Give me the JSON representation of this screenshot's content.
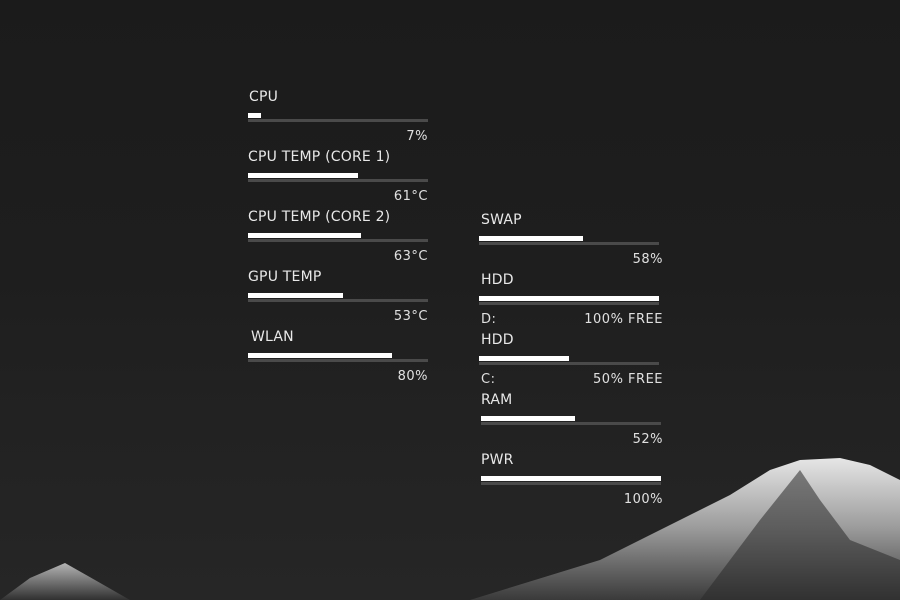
{
  "background": {
    "color": "#1e1e1e",
    "mountain_color": "#cfcfcf"
  },
  "bar_colors": {
    "fill": "#ffffff",
    "track": "#4a4a4a"
  },
  "left_column": {
    "cpu": {
      "title": "CPU",
      "value": "7%",
      "percent": 7
    },
    "core1": {
      "title": "CPU TEMP (CORE 1)",
      "value": "61°C",
      "percent": 61
    },
    "core2": {
      "title": "CPU TEMP (CORE 2)",
      "value": "63°C",
      "percent": 63
    },
    "gpu": {
      "title": "GPU TEMP",
      "value": "53°C",
      "percent": 53
    },
    "wlan": {
      "title": "WLAN",
      "value": "80%",
      "percent": 80
    }
  },
  "right_column": {
    "swap": {
      "title": "SWAP",
      "value": "58%",
      "percent": 58
    },
    "hdd_d": {
      "title": "HDD",
      "drive": "D:",
      "value": "100% FREE",
      "percent": 100
    },
    "hdd_c": {
      "title": "HDD",
      "drive": "C:",
      "value": "50% FREE",
      "percent": 50
    },
    "ram": {
      "title": "RAM",
      "value": "52%",
      "percent": 52
    },
    "pwr": {
      "title": "PWR",
      "value": "100%",
      "percent": 100
    }
  }
}
